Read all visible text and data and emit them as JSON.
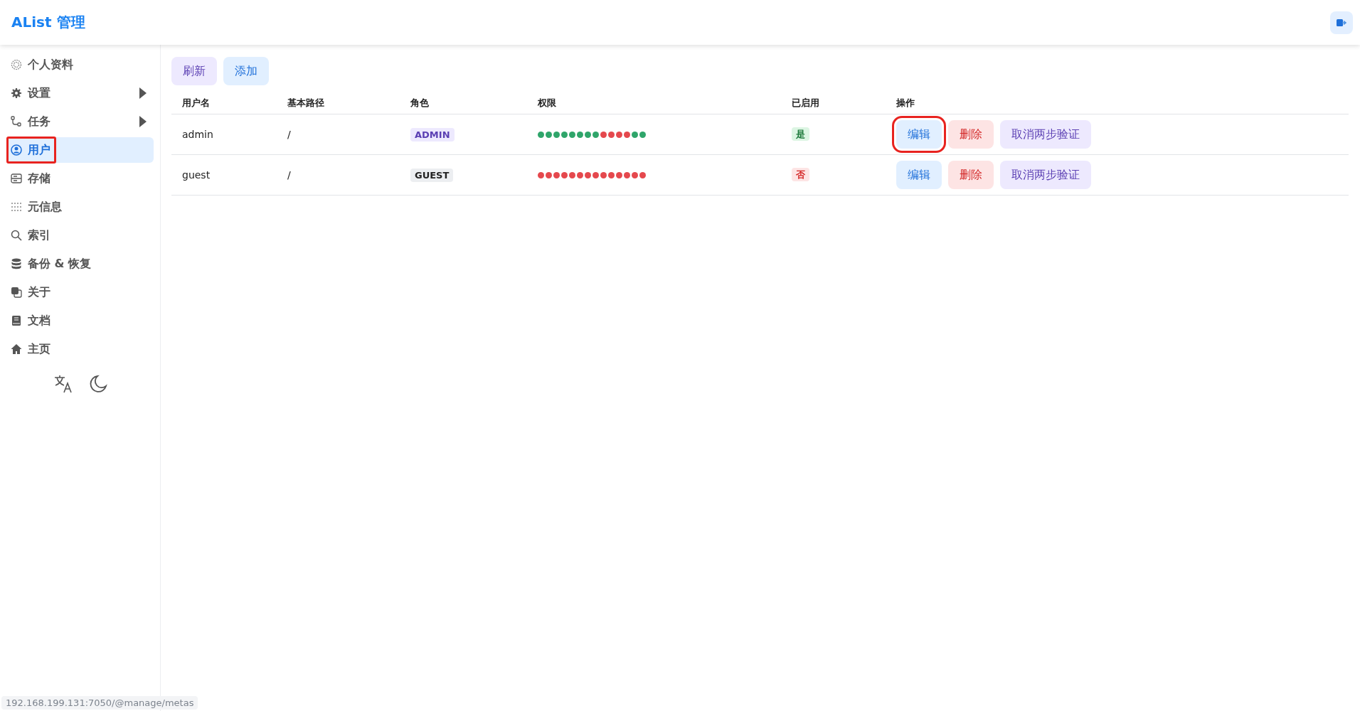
{
  "header": {
    "title": "AList 管理"
  },
  "sidebar": {
    "items": [
      {
        "label": "个人资料",
        "selected": false,
        "annotated": false
      },
      {
        "label": "设置",
        "selected": false,
        "annotated": false,
        "expanded": false
      },
      {
        "label": "任务",
        "selected": false,
        "annotated": false,
        "expanded": false
      },
      {
        "label": "用户",
        "selected": true,
        "annotated": true
      },
      {
        "label": "存储",
        "selected": false,
        "annotated": false
      },
      {
        "label": "元信息",
        "selected": false,
        "annotated": false
      },
      {
        "label": "索引",
        "selected": false,
        "annotated": false
      },
      {
        "label": "备份 & 恢复",
        "selected": false,
        "annotated": false
      },
      {
        "label": "关于",
        "selected": false,
        "annotated": false
      },
      {
        "label": "文档",
        "selected": false,
        "annotated": false
      },
      {
        "label": "主页",
        "selected": false,
        "annotated": false
      }
    ]
  },
  "toolbar": [
    {
      "label": "刷新",
      "kind": "refresh"
    },
    {
      "label": "添加",
      "kind": "add"
    }
  ],
  "table": {
    "columns": [
      "用户名",
      "基本路径",
      "角色",
      "权限",
      "已启用",
      "操作"
    ],
    "rows": [
      {
        "username": "admin",
        "base_path": "/",
        "role": {
          "label": "ADMIN",
          "kind": "admin"
        },
        "permissions": [
          true,
          true,
          true,
          true,
          true,
          true,
          true,
          true,
          false,
          false,
          false,
          false,
          true,
          true
        ],
        "enabled": true,
        "enabled_label": "是",
        "actions": [
          {
            "label": "编辑",
            "kind": "edit",
            "annotated": true
          },
          {
            "label": "删除",
            "kind": "delete",
            "annotated": false
          },
          {
            "label": "取消两步验证",
            "kind": "unbind",
            "annotated": false
          }
        ]
      },
      {
        "username": "guest",
        "base_path": "/",
        "role": {
          "label": "GUEST",
          "kind": "guest"
        },
        "permissions": [
          false,
          false,
          false,
          false,
          false,
          false,
          false,
          false,
          false,
          false,
          false,
          false,
          false,
          false
        ],
        "enabled": false,
        "enabled_label": "否",
        "actions": [
          {
            "label": "编辑",
            "kind": "edit",
            "annotated": false
          },
          {
            "label": "删除",
            "kind": "delete",
            "annotated": false
          },
          {
            "label": "取消两步验证",
            "kind": "unbind",
            "annotated": false
          }
        ]
      }
    ]
  },
  "status_link": "192.168.199.131:7050/@manage/metas"
}
